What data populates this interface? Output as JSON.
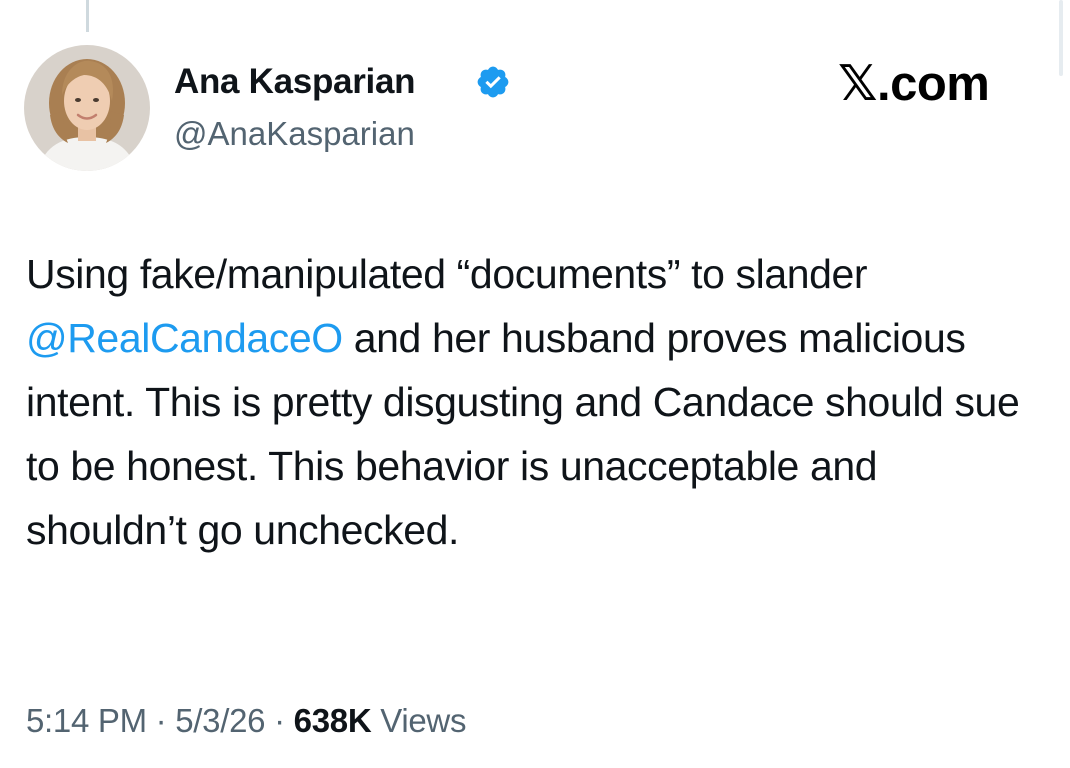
{
  "author": {
    "name": "Ana Kasparian",
    "handle": "@AnaKasparian",
    "verified": true,
    "verified_badge_color": "#1d9bf0"
  },
  "site_brand": {
    "x_glyph": "𝕏",
    "suffix": ".com"
  },
  "tweet": {
    "text_before_mention": "Using fake/manipulated “documents” to slander ",
    "mention": "@RealCandaceO",
    "text_after_mention": " and her husband proves malicious intent. This is pretty disgusting and Candace should sue to be honest. This behavior is unacceptable and shouldn’t go unchecked."
  },
  "meta": {
    "time": "5:14 PM",
    "separator": "·",
    "date": "5/3/26",
    "views_count": "638K",
    "views_label": "Views"
  },
  "colors": {
    "text": "#0f1419",
    "secondary_text": "#536471",
    "link": "#1d9bf0"
  }
}
